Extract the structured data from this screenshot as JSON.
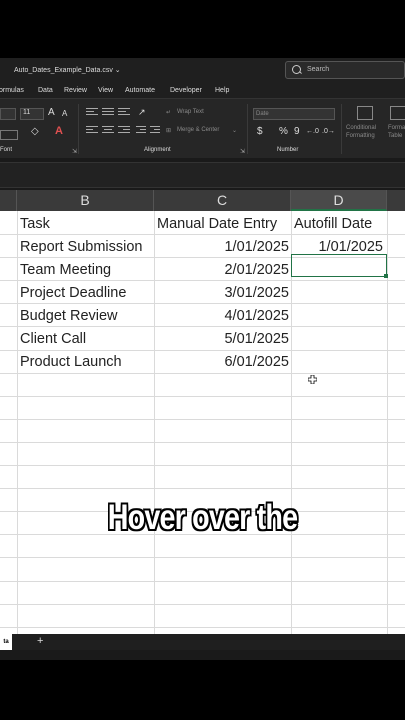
{
  "window": {
    "filename": "Auto_Dates_Example_Data.csv",
    "search_placeholder": "Search"
  },
  "menu": [
    "ormulas",
    "Data",
    "Review",
    "View",
    "Automate",
    "Developer",
    "Help"
  ],
  "ribbon": {
    "font_size": "11",
    "font_group_label": "Font",
    "alignment_label": "Alignment",
    "number_label": "Number",
    "wrap_text": "Wrap Text",
    "merge_center": "Merge & Center",
    "number_format": "Date",
    "conditional_formatting": "Conditional Formatting",
    "format_as_table": "Format as Table",
    "currency_symbol": "$",
    "percent_symbol": "%",
    "comma_symbol": "9"
  },
  "columns": [
    "B",
    "C",
    "D"
  ],
  "headers": {
    "task": "Task",
    "manual": "Manual Date Entry",
    "autofill": "Autofill Date"
  },
  "rows": [
    {
      "task": "Report Submission",
      "manual": "1/01/2025",
      "autofill": "1/01/2025"
    },
    {
      "task": "Team Meeting",
      "manual": "2/01/2025",
      "autofill": ""
    },
    {
      "task": "Project Deadline",
      "manual": "3/01/2025",
      "autofill": ""
    },
    {
      "task": "Budget Review",
      "manual": "4/01/2025",
      "autofill": ""
    },
    {
      "task": "Client Call",
      "manual": "5/01/2025",
      "autofill": ""
    },
    {
      "task": "Product Launch",
      "manual": "6/01/2025",
      "autofill": ""
    }
  ],
  "caption": "Hover over the",
  "sheet_tab": "ta",
  "add_sheet": "+",
  "colors": {
    "accent": "#217346",
    "selected_col_header": "#4a4a4a"
  }
}
